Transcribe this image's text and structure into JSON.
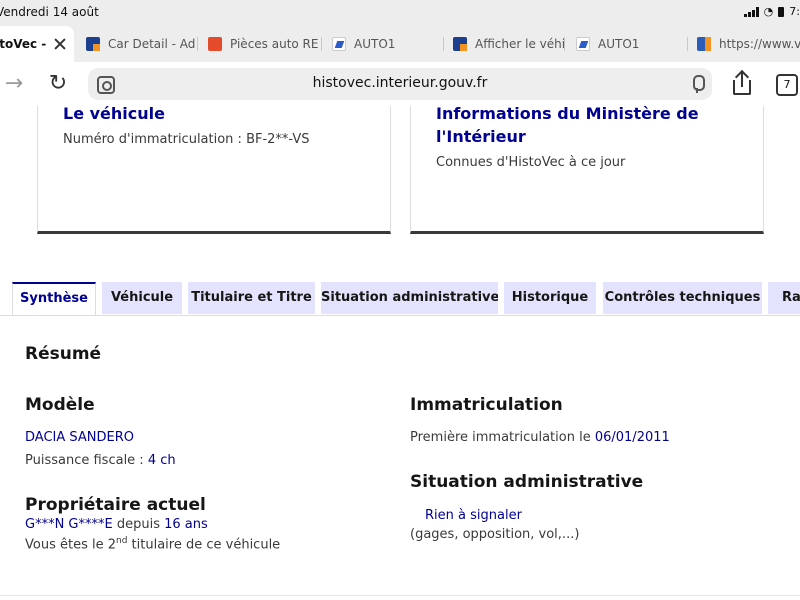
{
  "status_bar": {
    "time": "Vendredi 14 août",
    "clock": "7:"
  },
  "browser_tabs": [
    {
      "label": "istoVec -",
      "icon": "histovec-favicon",
      "active": true
    },
    {
      "label": "Car Detail - Ad",
      "icon": "car-detail-favicon"
    },
    {
      "label": "Pièces auto RE",
      "icon": "pieces-auto-favicon"
    },
    {
      "label": "AUTO1",
      "icon": "auto1-favicon"
    },
    {
      "label": "Afficher le véhi",
      "icon": "car-detail-favicon"
    },
    {
      "label": "AUTO1",
      "icon": "auto1-favicon"
    },
    {
      "label": "https://www.ve",
      "icon": "web-favicon"
    }
  ],
  "address_bar": {
    "url": "histovec.interieur.gouv.fr",
    "tab_count": "7"
  },
  "cards": {
    "vehicle": {
      "title": "Le véhicule",
      "plate_line": "Numéro d'immatriculation : BF-2**-VS"
    },
    "ministry": {
      "title_line1": "Informations du Ministère de",
      "title_line2": "l'Intérieur",
      "subtitle": "Connues d'HistoVec à ce jour"
    }
  },
  "page_tabs": [
    {
      "label": "Synthèse",
      "active": true
    },
    {
      "label": "Véhicule"
    },
    {
      "label": "Titulaire et Titre"
    },
    {
      "label": "Situation administrative"
    },
    {
      "label": "Historique"
    },
    {
      "label": "Contrôles techniques"
    },
    {
      "label": "Rap"
    }
  ],
  "summary": {
    "heading": "Résumé",
    "model": {
      "heading": "Modèle",
      "name": "DACIA SANDERO",
      "fiscal_label": "Puissance fiscale : ",
      "fiscal_value": "4 ch"
    },
    "registration": {
      "heading": "Immatriculation",
      "first_label": "Première immatriculation le ",
      "first_date": "06/01/2011"
    },
    "owner": {
      "heading": "Propriétaire actuel",
      "name": "G***N G****E",
      "since_label": " depuis ",
      "since_value": "16 ans",
      "line_prefix": "Vous êtes le 2",
      "line_sup": "nd",
      "line_suffix": " titulaire de ce véhicule"
    },
    "admin": {
      "heading": "Situation administrative",
      "status": "Rien à signaler",
      "details": "(gages, opposition, vol,...)"
    }
  },
  "colors": {
    "brand_blue": "#000091",
    "tab_bg": "#e3e3fd",
    "text": "#3a3a3a"
  }
}
